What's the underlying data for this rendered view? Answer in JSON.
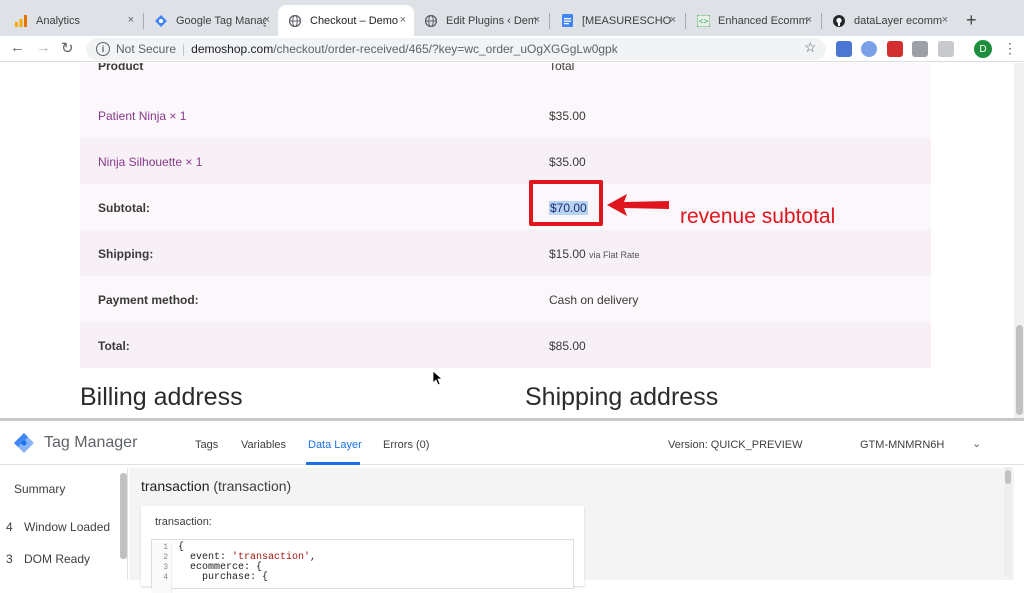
{
  "browser": {
    "tabs": [
      {
        "label": "Analytics",
        "icon": "analytics-icon"
      },
      {
        "label": "Google Tag Manag",
        "icon": "gtm-icon"
      },
      {
        "label": "Checkout – Demo",
        "icon": "globe-icon",
        "active": true
      },
      {
        "label": "Edit Plugins ‹ Dem",
        "icon": "globe-icon"
      },
      {
        "label": "[MEASURESCHOO",
        "icon": "docs-icon"
      },
      {
        "label": "Enhanced Ecomm",
        "icon": "code-icon"
      },
      {
        "label": "dataLayer ecomm",
        "icon": "github-icon"
      }
    ],
    "close_glyph": "×",
    "new_tab_glyph": "+",
    "security": "Not Secure",
    "url_host": "demoshop.com",
    "url_path": "/checkout/order-received/465/?key=wc_order_uOgXGGgLw0gpk",
    "profile_initial": "D"
  },
  "order": {
    "header_product": "Product",
    "header_total": "Total",
    "rows": [
      {
        "label": "Patient Ninja × 1",
        "value": "$35.00"
      },
      {
        "label": "Ninja Silhouette × 1",
        "value": "$35.00"
      },
      {
        "label": "Subtotal:",
        "value": "$70.00"
      },
      {
        "label": "Shipping:",
        "value": "$15.00",
        "note": "via Flat Rate"
      },
      {
        "label": "Payment method:",
        "value": "Cash on delivery"
      },
      {
        "label": "Total:",
        "value": "$85.00"
      }
    ]
  },
  "annotation": {
    "text": "revenue subtotal",
    "color": "#e0161e"
  },
  "headings": {
    "billing": "Billing address",
    "shipping": "Shipping address"
  },
  "gtm": {
    "title": "Tag Manager",
    "tabs": [
      "Tags",
      "Variables",
      "Data Layer",
      "Errors (0)"
    ],
    "active_tab": "Data Layer",
    "version": "Version: QUICK_PREVIEW",
    "container_id": "GTM-MNMRN6H",
    "sidebar": [
      {
        "num": "",
        "label": "Summary"
      },
      {
        "num": "4",
        "label": "Window Loaded"
      },
      {
        "num": "3",
        "label": "DOM Ready"
      }
    ],
    "event_title": "transaction",
    "event_sub": "(transaction)",
    "card_title": "transaction:",
    "code": {
      "gutter": [
        "1",
        "2",
        "3",
        "4"
      ],
      "line1": "{",
      "line2_key": "  event: ",
      "line2_val": "'transaction'",
      "line2_end": ",",
      "line3": "  ecommerce: {",
      "line4": "    purchase: {"
    }
  }
}
